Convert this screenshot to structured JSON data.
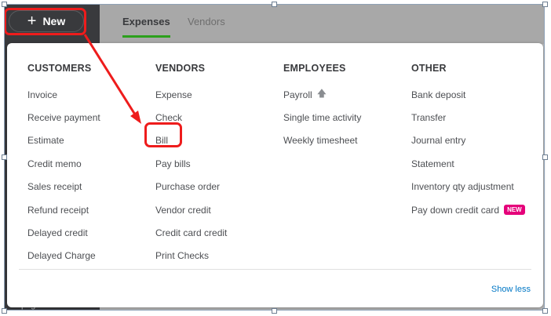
{
  "header": {
    "new_button": {
      "label": "New",
      "icon": "plus-icon"
    },
    "tabs": [
      {
        "label": "Expenses",
        "active": true
      },
      {
        "label": "Vendors",
        "active": false
      }
    ]
  },
  "sidebar": {
    "bottom_text": "ullpage"
  },
  "menu": {
    "columns": [
      {
        "heading": "CUSTOMERS",
        "items": [
          "Invoice",
          "Receive payment",
          "Estimate",
          "Credit memo",
          "Sales receipt",
          "Refund receipt",
          "Delayed credit",
          "Delayed Charge"
        ]
      },
      {
        "heading": "VENDORS",
        "items": [
          "Expense",
          "Check",
          "Bill",
          "Pay bills",
          "Purchase order",
          "Vendor credit",
          "Credit card credit",
          "Print Checks"
        ]
      },
      {
        "heading": "EMPLOYEES",
        "items": [
          "Payroll",
          "Single time activity",
          "Weekly timesheet"
        ]
      },
      {
        "heading": "OTHER",
        "items": [
          "Bank deposit",
          "Transfer",
          "Journal entry",
          "Statement",
          "Inventory qty adjustment",
          "Pay down credit card"
        ],
        "badge": "NEW"
      }
    ],
    "footer_link": "Show less"
  },
  "colors": {
    "accent_green": "#2ca01c",
    "annotation_red": "#ee1c1c",
    "link_blue": "#0077c5",
    "badge_pink": "#e5007a"
  }
}
